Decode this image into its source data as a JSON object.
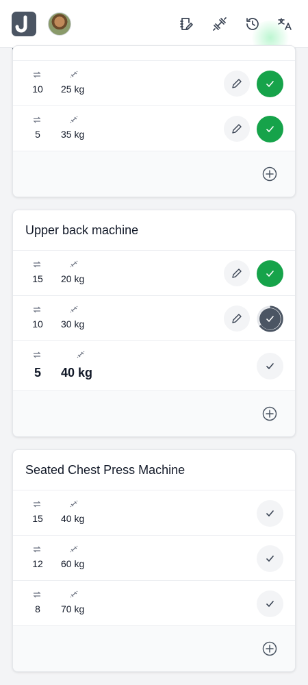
{
  "header": {
    "logo_icon": "app-logo-j",
    "avatar_icon": "user-avatar",
    "icons": [
      "notebook-edit-icon",
      "dumbbell-icon",
      "history-icon",
      "translate-icon"
    ]
  },
  "progress": {
    "fraction": 0.5
  },
  "colors": {
    "accent": "#4b5563",
    "done": "#16a34a"
  },
  "cards": [
    {
      "title": "",
      "sets": [
        {
          "reps": "10",
          "weight": "25 kg",
          "status": "done"
        },
        {
          "reps": "5",
          "weight": "35 kg",
          "status": "done"
        }
      ]
    },
    {
      "title": "Upper back machine",
      "sets": [
        {
          "reps": "15",
          "weight": "20 kg",
          "status": "done"
        },
        {
          "reps": "10",
          "weight": "30 kg",
          "status": "active"
        },
        {
          "reps": "5",
          "weight": "40 kg",
          "status": "current"
        }
      ]
    },
    {
      "title": "Seated Chest Press Machine",
      "sets": [
        {
          "reps": "15",
          "weight": "40 kg",
          "status": "todo"
        },
        {
          "reps": "12",
          "weight": "60 kg",
          "status": "todo"
        },
        {
          "reps": "8",
          "weight": "70 kg",
          "status": "todo"
        }
      ]
    }
  ]
}
